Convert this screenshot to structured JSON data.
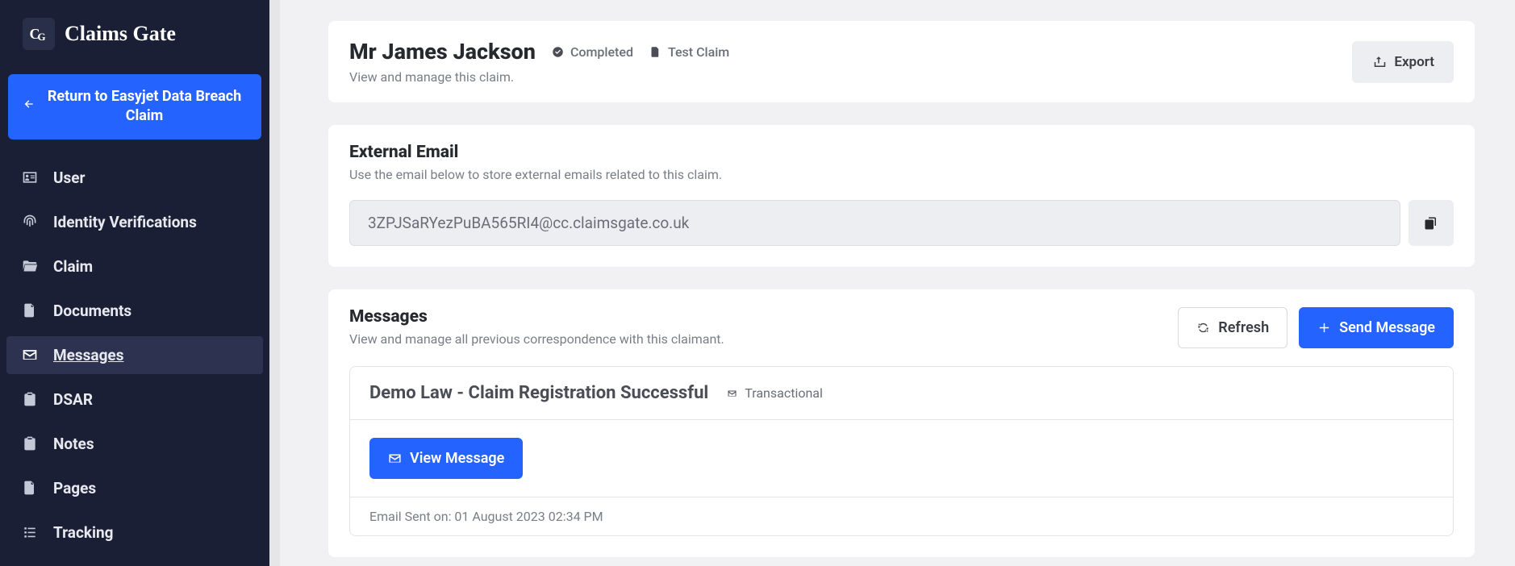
{
  "brand": {
    "name": "Claims Gate",
    "logo_text": "CG"
  },
  "return_btn": "Return to Easyjet Data Breach Claim",
  "sidebar": {
    "items": [
      {
        "label": "User",
        "icon": "id-card-icon",
        "active": false
      },
      {
        "label": "Identity Verifications",
        "icon": "fingerprint-icon",
        "active": false
      },
      {
        "label": "Claim",
        "icon": "folder-open-icon",
        "active": false
      },
      {
        "label": "Documents",
        "icon": "file-icon",
        "active": false
      },
      {
        "label": "Messages",
        "icon": "envelope-icon",
        "active": true
      },
      {
        "label": "DSAR",
        "icon": "clipboard-icon",
        "active": false
      },
      {
        "label": "Notes",
        "icon": "clipboard-icon",
        "active": false
      },
      {
        "label": "Pages",
        "icon": "file-icon",
        "active": false
      },
      {
        "label": "Tracking",
        "icon": "list-icon",
        "active": false
      }
    ]
  },
  "header": {
    "name": "Mr James Jackson",
    "status": "Completed",
    "claim_type": "Test Claim",
    "subtitle": "View and manage this claim.",
    "export_label": "Export"
  },
  "external_email": {
    "title": "External Email",
    "subtitle": "Use the email below to store external emails related to this claim.",
    "address": "3ZPJSaRYezPuBA565RI4@cc.claimsgate.co.uk"
  },
  "messages": {
    "title": "Messages",
    "subtitle": "View and manage all previous correspondence with this claimant.",
    "refresh_label": "Refresh",
    "send_label": "Send Message",
    "items": [
      {
        "title": "Demo Law - Claim Registration Successful",
        "tag": "Transactional",
        "view_label": "View Message",
        "footer": "Email Sent on: 01 August 2023 02:34 PM"
      }
    ]
  }
}
